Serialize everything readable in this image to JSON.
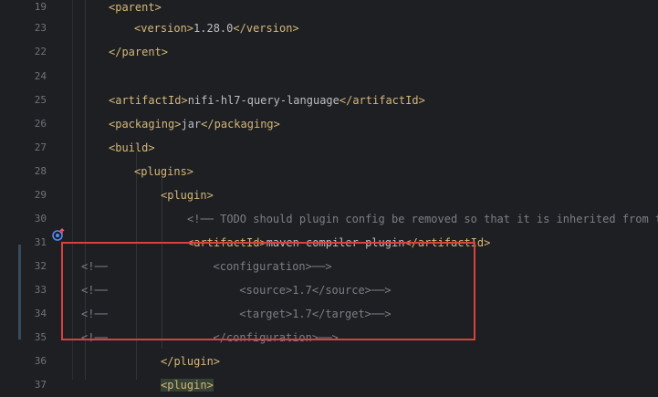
{
  "editor": {
    "lines": [
      {
        "num": "19",
        "parts": [
          {
            "t": "<parent>",
            "c": "tag"
          }
        ]
      },
      {
        "num": "23",
        "parts": [
          {
            "t": "<version>",
            "c": "tag"
          },
          {
            "t": "1.28.0",
            "c": "text"
          },
          {
            "t": "</version>",
            "c": "tag"
          }
        ]
      },
      {
        "num": "22",
        "parts": [
          {
            "t": "</parent>",
            "c": "tag"
          }
        ]
      },
      {
        "num": "24",
        "parts": []
      },
      {
        "num": "25",
        "parts": [
          {
            "t": "<artifactId>",
            "c": "tag"
          },
          {
            "t": "nifi-hl7-query-language",
            "c": "text"
          },
          {
            "t": "</artifactId>",
            "c": "tag"
          }
        ]
      },
      {
        "num": "26",
        "parts": [
          {
            "t": "<packaging>",
            "c": "tag"
          },
          {
            "t": "jar",
            "c": "text"
          },
          {
            "t": "</packaging>",
            "c": "tag"
          }
        ]
      },
      {
        "num": "27",
        "parts": [
          {
            "t": "<build>",
            "c": "tag"
          }
        ]
      },
      {
        "num": "28",
        "parts": [
          {
            "t": "<plugins>",
            "c": "tag"
          }
        ]
      },
      {
        "num": "29",
        "parts": [
          {
            "t": "<plugin>",
            "c": "tag"
          }
        ]
      },
      {
        "num": "30",
        "parts": [
          {
            "t": "<!── TODO should plugin config be removed so that it is inherited from t",
            "c": "comment"
          }
        ]
      },
      {
        "num": "31",
        "parts": [
          {
            "t": "<artifactId>",
            "c": "tag"
          },
          {
            "t": "maven-compiler-plugin",
            "c": "text"
          },
          {
            "t": "</artifactId>",
            "c": "tag"
          }
        ]
      },
      {
        "num": "32",
        "parts": [
          {
            "t": "<!──",
            "c": "comment"
          },
          {
            "t": "                <configuration>──>",
            "c": "comment"
          }
        ]
      },
      {
        "num": "33",
        "parts": [
          {
            "t": "<!──",
            "c": "comment"
          },
          {
            "t": "                    <source>1.7</source>──>",
            "c": "comment"
          }
        ]
      },
      {
        "num": "34",
        "parts": [
          {
            "t": "<!──",
            "c": "comment"
          },
          {
            "t": "                    <target>1.7</target>──>",
            "c": "comment"
          }
        ]
      },
      {
        "num": "35",
        "parts": [
          {
            "t": "<!──",
            "c": "comment"
          },
          {
            "t": "                </configuration>──>",
            "c": "comment"
          }
        ]
      },
      {
        "num": "36",
        "parts": [
          {
            "t": "</plugin>",
            "c": "tag"
          }
        ]
      },
      {
        "num": "37",
        "parts": [
          {
            "t": "<plugin>",
            "c": "tag"
          }
        ]
      }
    ],
    "gutter_icon": "override-method-icon",
    "colors": {
      "background": "#1e1f22",
      "tag": "#d5b778",
      "text": "#bcbec4",
      "comment": "#7a7e85",
      "line_number": "#6f737a",
      "highlight_border": "#d9413a"
    }
  }
}
